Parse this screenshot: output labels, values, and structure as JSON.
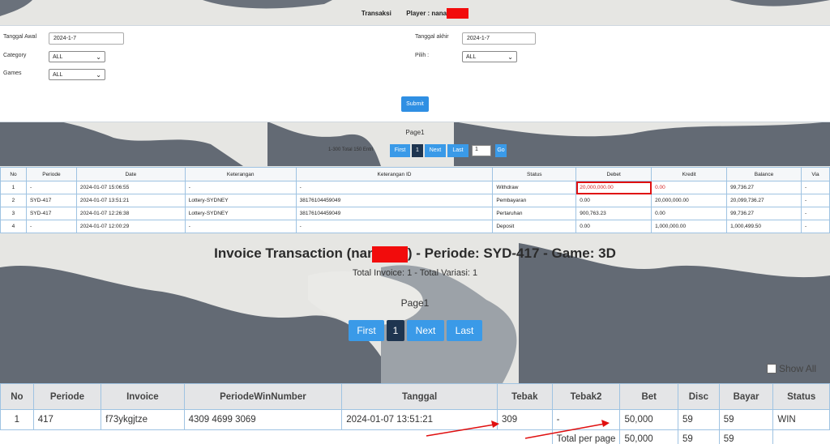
{
  "header": {
    "title": "Transaksi",
    "player_label": "Player : nana"
  },
  "form": {
    "tanggal_awal_label": "Tanggal Awal",
    "tanggal_awal_value": "2024-1-7",
    "category_label": "Category",
    "category_value": "ALL",
    "games_label": "Games",
    "games_value": "ALL",
    "tanggal_akhir_label": "Tanggal akhir",
    "tanggal_akhir_value": "2024-1-7",
    "pilih_label": "Pilih  :",
    "pilih_value": "ALL",
    "submit_label": "Submit"
  },
  "pager_small": {
    "page_label": "Page1",
    "info": "1-300 Total 150 Entri",
    "first": "First",
    "current": "1",
    "next": "Next",
    "last": "Last",
    "input_value": "1",
    "go": "Go"
  },
  "transactions": {
    "headers": [
      "No",
      "Periode",
      "Date",
      "Keterangan",
      "Keterangan ID",
      "Status",
      "Debet",
      "Kredit",
      "Balance",
      "Via"
    ],
    "rows": [
      [
        "1",
        "-",
        "2024-01-07 15:06:55",
        "-",
        "-",
        "Withdraw",
        "20,000,000.00",
        "0.00",
        "99,736.27",
        "-"
      ],
      [
        "2",
        "SYD-417",
        "2024-01-07 13:51:21",
        "Lottery-SYDNEY",
        "38176104459049",
        "Pembayaran",
        "0.00",
        "20,000,000.00",
        "20,099,736.27",
        "-"
      ],
      [
        "3",
        "SYD-417",
        "2024-01-07 12:26:38",
        "Lottery-SYDNEY",
        "38176104459049",
        "Pertaruhan",
        "900,763.23",
        "0.00",
        "99,736.27",
        "-"
      ],
      [
        "4",
        "-",
        "2024-01-07 12:00:29",
        "-",
        "-",
        "Deposit",
        "0.00",
        "1,000,000.00",
        "1,000,499.50",
        "-"
      ]
    ]
  },
  "invoice": {
    "title_prefix": "Invoice Transaction (nana",
    "title_suffix": ") - Periode: SYD-417 - Game: 3D",
    "subtitle": "Total Invoice: 1 - Total Variasi: 1",
    "page_label": "Page1",
    "pager": {
      "first": "First",
      "current": "1",
      "next": "Next",
      "last": "Last"
    },
    "show_all_label": "Show All",
    "headers": [
      "No",
      "Periode",
      "Invoice",
      "PeriodeWinNumber",
      "Tanggal",
      "Tebak",
      "Tebak2",
      "Bet",
      "Disc",
      "Bayar",
      "Status"
    ],
    "rows": [
      [
        "1",
        "417",
        "f73ykgjtze",
        "4309 4699 3069",
        "2024-01-07 13:51:21",
        "309",
        "-",
        "50,000",
        "59",
        "59",
        "WIN"
      ]
    ],
    "footer": {
      "label": "Total per page",
      "bet": "50,000",
      "disc": "59",
      "bayar": "59"
    }
  },
  "colors": {
    "accent_blue": "#3a9ae8",
    "active_page": "#1e3550",
    "redaction": "#f20c0c",
    "highlight_red": "#e01010"
  }
}
